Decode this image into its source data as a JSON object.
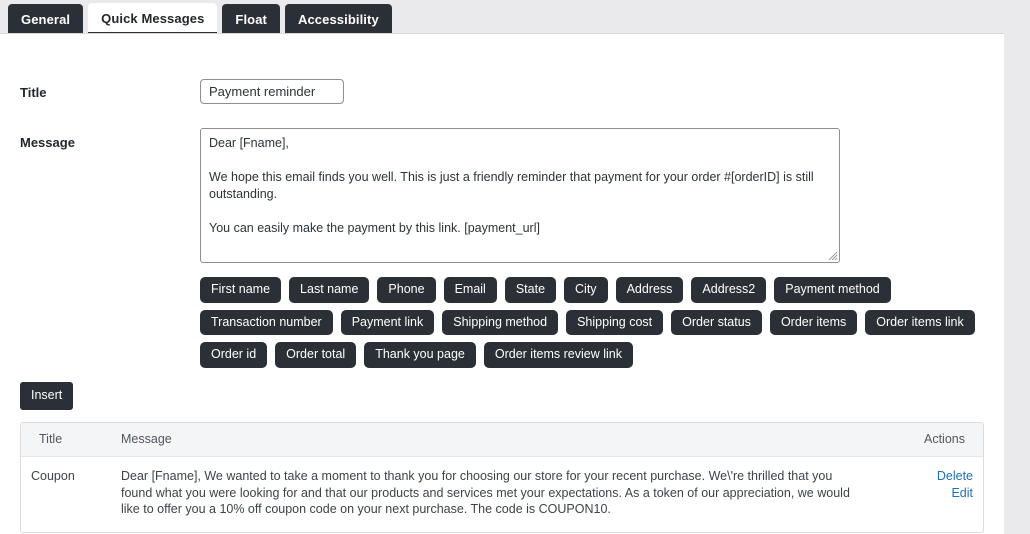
{
  "tabs": [
    {
      "label": "General",
      "active": false
    },
    {
      "label": "Quick Messages",
      "active": true
    },
    {
      "label": "Float",
      "active": false
    },
    {
      "label": "Accessibility",
      "active": false
    }
  ],
  "form": {
    "title_label": "Title",
    "title_value": "Payment reminder",
    "title_placeholder": "",
    "message_label": "Message",
    "message_value": "Dear [Fname],\n\nWe hope this email finds you well. This is just a friendly reminder that payment for your order #[orderID] is still outstanding.\n\nYou can easily make the payment by this link. [payment_url]",
    "message_placeholder": "",
    "insert_label": "Insert"
  },
  "tags": [
    "First name",
    "Last name",
    "Phone",
    "Email",
    "State",
    "City",
    "Address",
    "Address2",
    "Payment method",
    "Transaction number",
    "Payment link",
    "Shipping method",
    "Shipping cost",
    "Order status",
    "Order items",
    "Order items link",
    "Order id",
    "Order total",
    "Thank you page",
    "Order items review link"
  ],
  "table": {
    "columns": [
      "Title",
      "Message",
      "Actions"
    ],
    "rows": [
      {
        "title": "Coupon",
        "message": "Dear [Fname], We wanted to take a moment to thank you for choosing our store for your recent purchase. We\\'re thrilled that you found what you were looking for and that our products and services met your expectations. As a token of our appreciation, we would like to offer you a 10% off coupon code on your next purchase. The code is COUPON10.",
        "actions": [
          "Delete",
          "Edit"
        ]
      }
    ]
  },
  "colors": {
    "dark": "#2b2f36",
    "strip": "#eaeaec",
    "link": "#2271b1",
    "header_bg": "#f4f5f6",
    "border": "#dcdcde"
  }
}
